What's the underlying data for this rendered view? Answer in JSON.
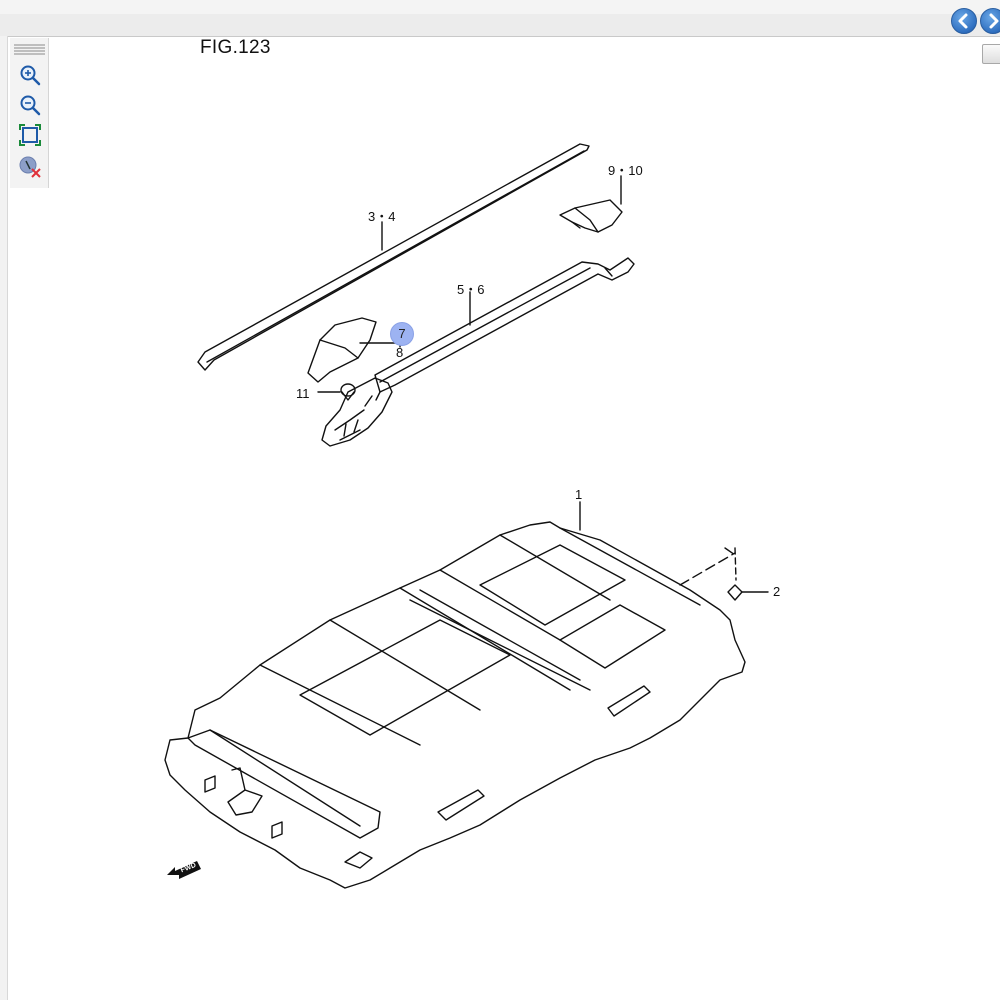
{
  "figure": {
    "title": "FIG.123"
  },
  "toolbar": {
    "items": [
      {
        "icon": "zoom-in-icon"
      },
      {
        "icon": "zoom-out-icon"
      },
      {
        "icon": "fit-to-window-icon"
      },
      {
        "icon": "clear-highlight-icon"
      }
    ]
  },
  "navigation": {
    "back_icon": "back-arrow-icon",
    "forward_icon": "forward-arrow-icon"
  },
  "callouts": {
    "c1": "1",
    "c2": "2",
    "c34": "3・4",
    "c56": "5・6",
    "c7": "7",
    "c8": "8",
    "c910": "9・10",
    "c11": "11"
  },
  "fwd_label": "FWD",
  "colors": {
    "highlight": "#9db3f2",
    "nav": "#2f6fc0"
  }
}
